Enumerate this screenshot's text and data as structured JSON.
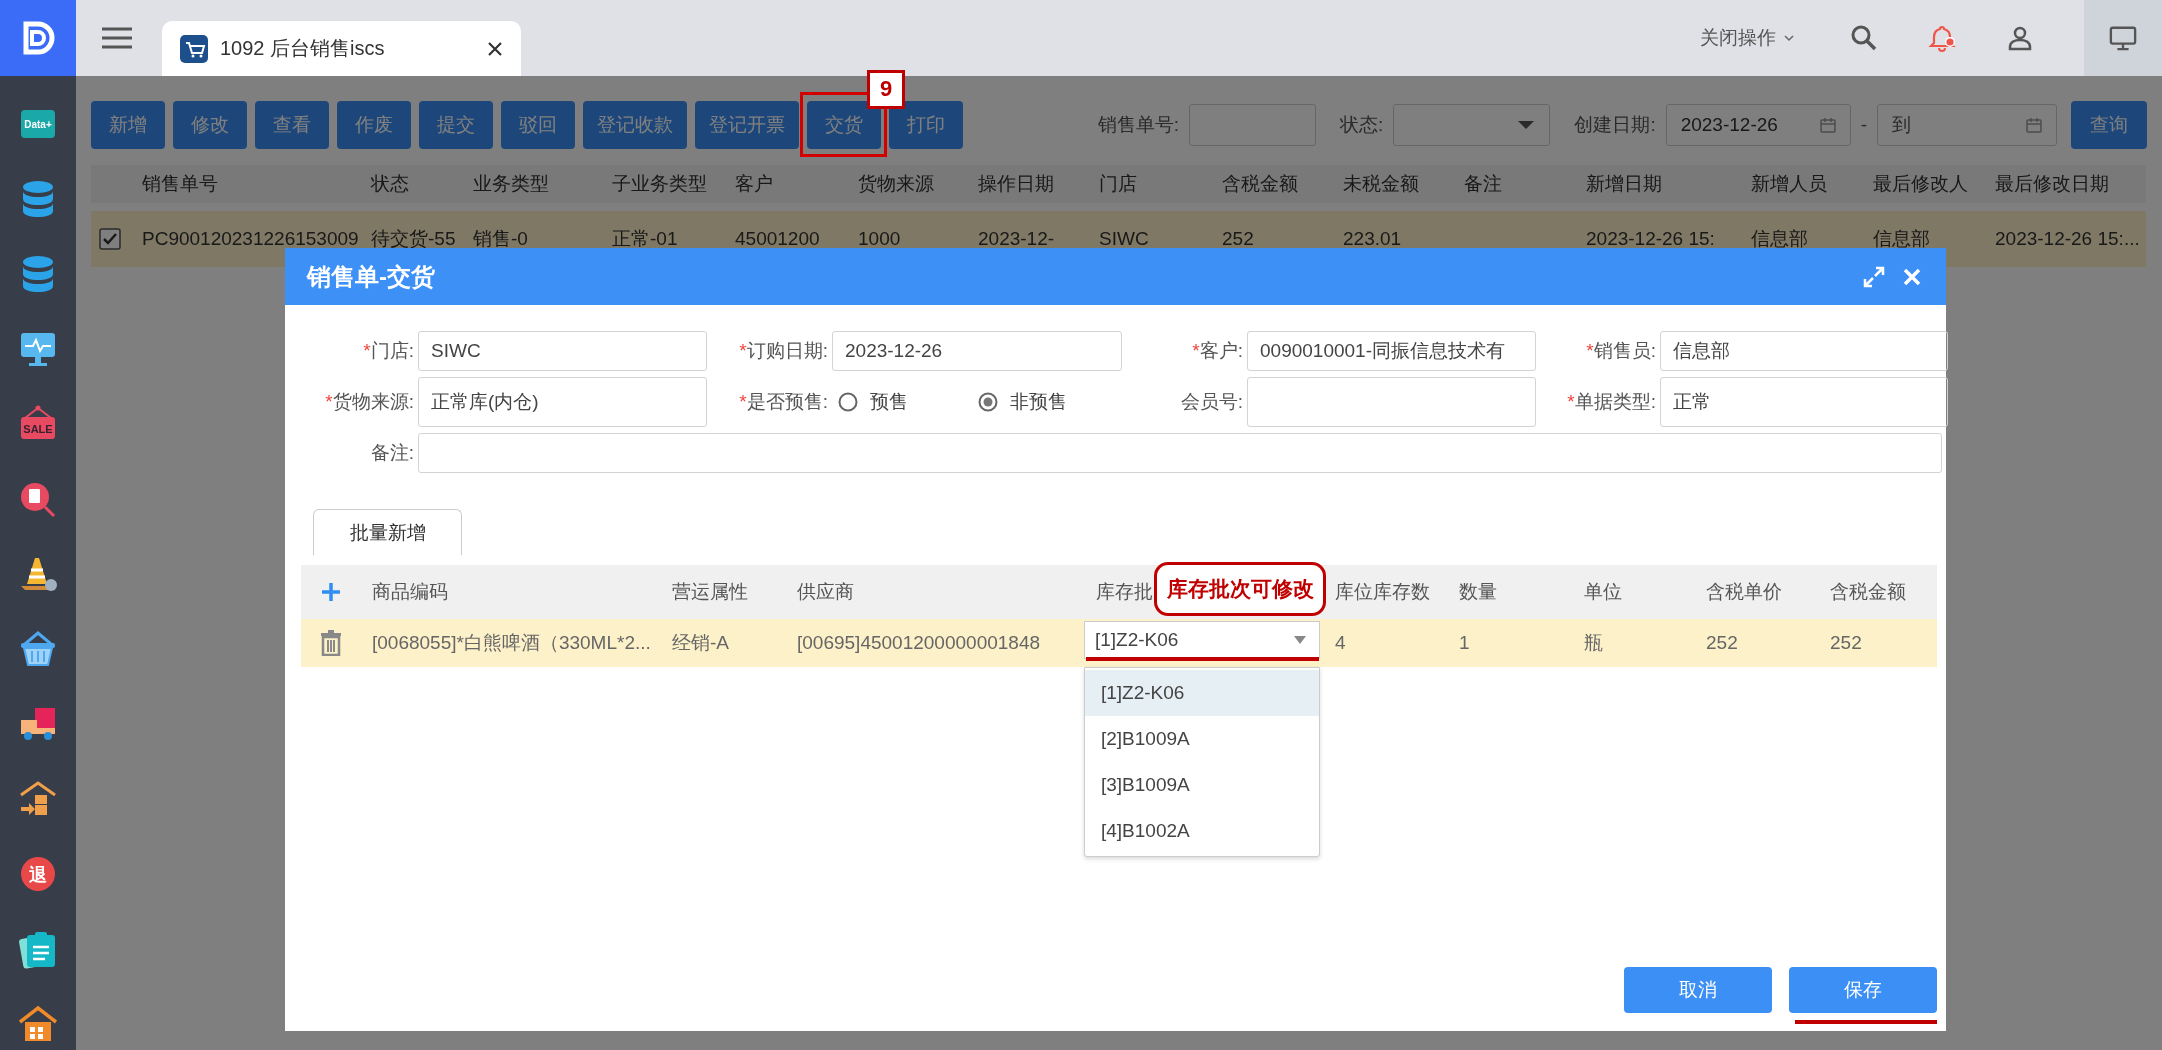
{
  "sidebar": {
    "items": [
      {
        "kind": "data",
        "label": "Data+"
      },
      {
        "kind": "database"
      },
      {
        "kind": "database"
      },
      {
        "kind": "monitor"
      },
      {
        "kind": "sale",
        "label": "SALE"
      },
      {
        "kind": "search-doc"
      },
      {
        "kind": "cone"
      },
      {
        "kind": "basket"
      },
      {
        "kind": "truck"
      },
      {
        "kind": "warehouse-in"
      },
      {
        "kind": "return",
        "label": "退"
      },
      {
        "kind": "clipboard"
      },
      {
        "kind": "house"
      }
    ]
  },
  "topbar": {
    "tabs": [
      {
        "label": "1092 后台销售iscs",
        "selected": true
      }
    ],
    "close_menu": "关闭操作",
    "notification_dot": true
  },
  "toolbar": {
    "buttons": [
      {
        "label": "新增"
      },
      {
        "label": "修改"
      },
      {
        "label": "查看"
      },
      {
        "label": "作废"
      },
      {
        "label": "提交"
      },
      {
        "label": "驳回"
      },
      {
        "label": "登记收款"
      },
      {
        "label": "登记开票"
      },
      {
        "label": "交货",
        "step_marker": "9"
      },
      {
        "label": "打印"
      }
    ],
    "filters": {
      "order_no_label": "销售单号:",
      "status_label": "状态:",
      "date_label": "创建日期:",
      "date_from": "2023-12-26",
      "date_separator": "-",
      "date_to_placeholder": "到",
      "query_button": "查询"
    }
  },
  "orders_table": {
    "columns": [
      "销售单号",
      "状态",
      "业务类型",
      "子业务类型",
      "客户",
      "货物来源",
      "操作日期",
      "门店",
      "含税金额",
      "未税金额",
      "备注",
      "新增日期",
      "新增人员",
      "最后修改人",
      "最后修改日期"
    ],
    "rows": [
      {
        "checked": true,
        "cells": [
          "PC900120231226153009",
          "待交货-55",
          "销售-0",
          "正常-01",
          "45001200",
          "1000",
          "2023-12-",
          "SIWC",
          "252",
          "223.01",
          null,
          "2023-12-26 15:",
          "信息部",
          "信息部",
          "2023-12-26 15:..."
        ]
      }
    ]
  },
  "dialog": {
    "title": "销售单-交货",
    "form": [
      {
        "kind": "text",
        "required_mark": "*",
        "label": "门店:",
        "value": "SIWC"
      },
      {
        "kind": "text",
        "required_mark": "*",
        "label": "订购日期:",
        "value": "2023-12-26"
      },
      {
        "kind": "text",
        "required_mark": "*",
        "label": "客户:",
        "value": "0090010001-同振信息技术有"
      },
      {
        "kind": "text",
        "required_mark": "*",
        "label": "销售员:",
        "value": "信息部"
      },
      {
        "kind": "text",
        "required_mark": "*",
        "label": "货物来源:",
        "value": "正常库(内仓)"
      },
      {
        "kind": "radio",
        "required_mark": "*",
        "label": "是否预售:",
        "options": [
          {
            "label": "预售",
            "selected": false
          },
          {
            "label": "非预售",
            "selected": true
          }
        ]
      },
      {
        "kind": "text",
        "label": "会员号:"
      },
      {
        "kind": "text",
        "required_mark": "*",
        "label": "单据类型:",
        "value": "正常"
      },
      {
        "kind": "wide",
        "label": "备注:"
      }
    ],
    "batch_add_button": "批量新增",
    "lines": {
      "columns": [
        "商品编码",
        "营运属性",
        "供应商",
        "库存批",
        "库位库存数",
        "数量",
        "单位",
        "含税单价",
        "含税金额"
      ],
      "rows": [
        {
          "product": "[0068055]*白熊啤酒（330ML*2...",
          "attribute": "经销-A",
          "supplier": "[00695]45001200000001848",
          "batch": {
            "value": "[1]Z2-K06",
            "callout": "库存批次可修改",
            "underlined": true
          },
          "stock": "4",
          "quantity": "1",
          "unit": "瓶",
          "unit_price": "252",
          "amount": "252"
        }
      ],
      "batch_options": [
        {
          "label": "[1]Z2-K06",
          "selected": true
        },
        {
          "label": "[2]B1009A",
          "selected": false
        },
        {
          "label": "[3]B1009A",
          "selected": false
        },
        {
          "label": "[4]B1002A",
          "selected": false
        }
      ]
    },
    "buttons": [
      {
        "label": "取消"
      },
      {
        "label": "保存",
        "underlined": true
      }
    ]
  }
}
